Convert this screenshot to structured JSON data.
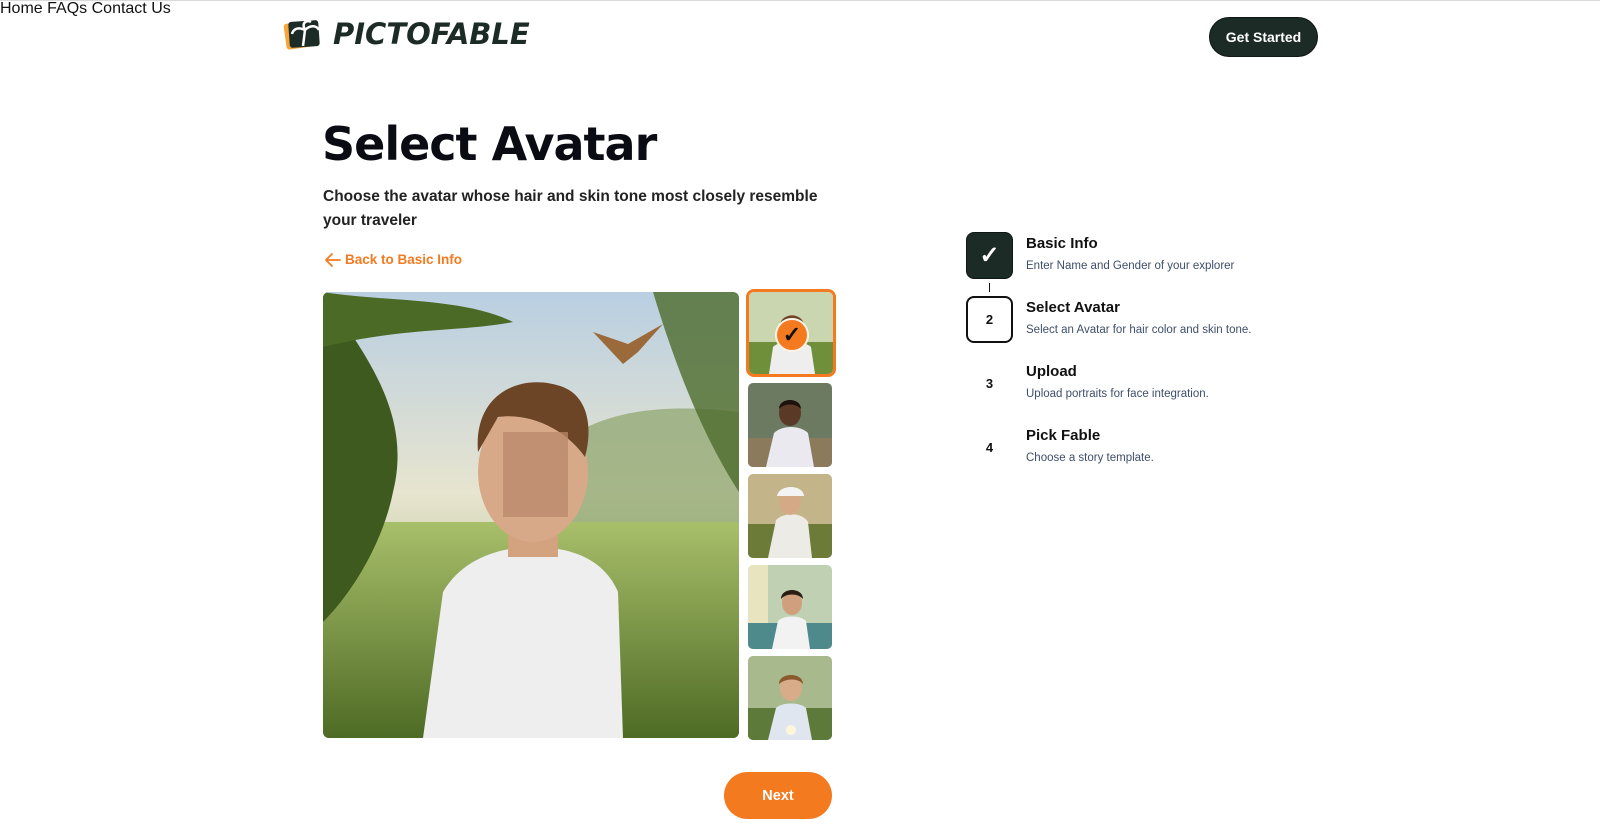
{
  "header": {
    "brand": "PICTOFABLE",
    "nav": [
      {
        "label": "Home"
      },
      {
        "label": "FAQs"
      },
      {
        "label": "Contact Us"
      }
    ],
    "cta_label": "Get Started"
  },
  "main": {
    "title": "Select Avatar",
    "subtitle": "Choose the avatar whose hair and skin tone most closely resemble your traveler",
    "back_link": "Back to Basic Info",
    "selected_thumb_index": 0,
    "thumb_count": 5,
    "next_label": "Next"
  },
  "steps": [
    {
      "marker": "✓",
      "title": "Basic Info",
      "desc": "Enter Name and Gender of your explorer",
      "state": "done"
    },
    {
      "marker": "2",
      "title": "Select Avatar",
      "desc": "Select an Avatar for hair color and skin tone.",
      "state": "active"
    },
    {
      "marker": "3",
      "title": "Upload",
      "desc": "Upload portraits for face integration.",
      "state": "pending"
    },
    {
      "marker": "4",
      "title": "Pick Fable",
      "desc": "Choose a story template.",
      "state": "pending"
    }
  ],
  "colors": {
    "accent": "#f47a20",
    "dark": "#1c2b26",
    "muted_text": "#3e4f6a"
  },
  "icons": {
    "back": "arrow-left-icon",
    "check": "checkmark-icon"
  }
}
